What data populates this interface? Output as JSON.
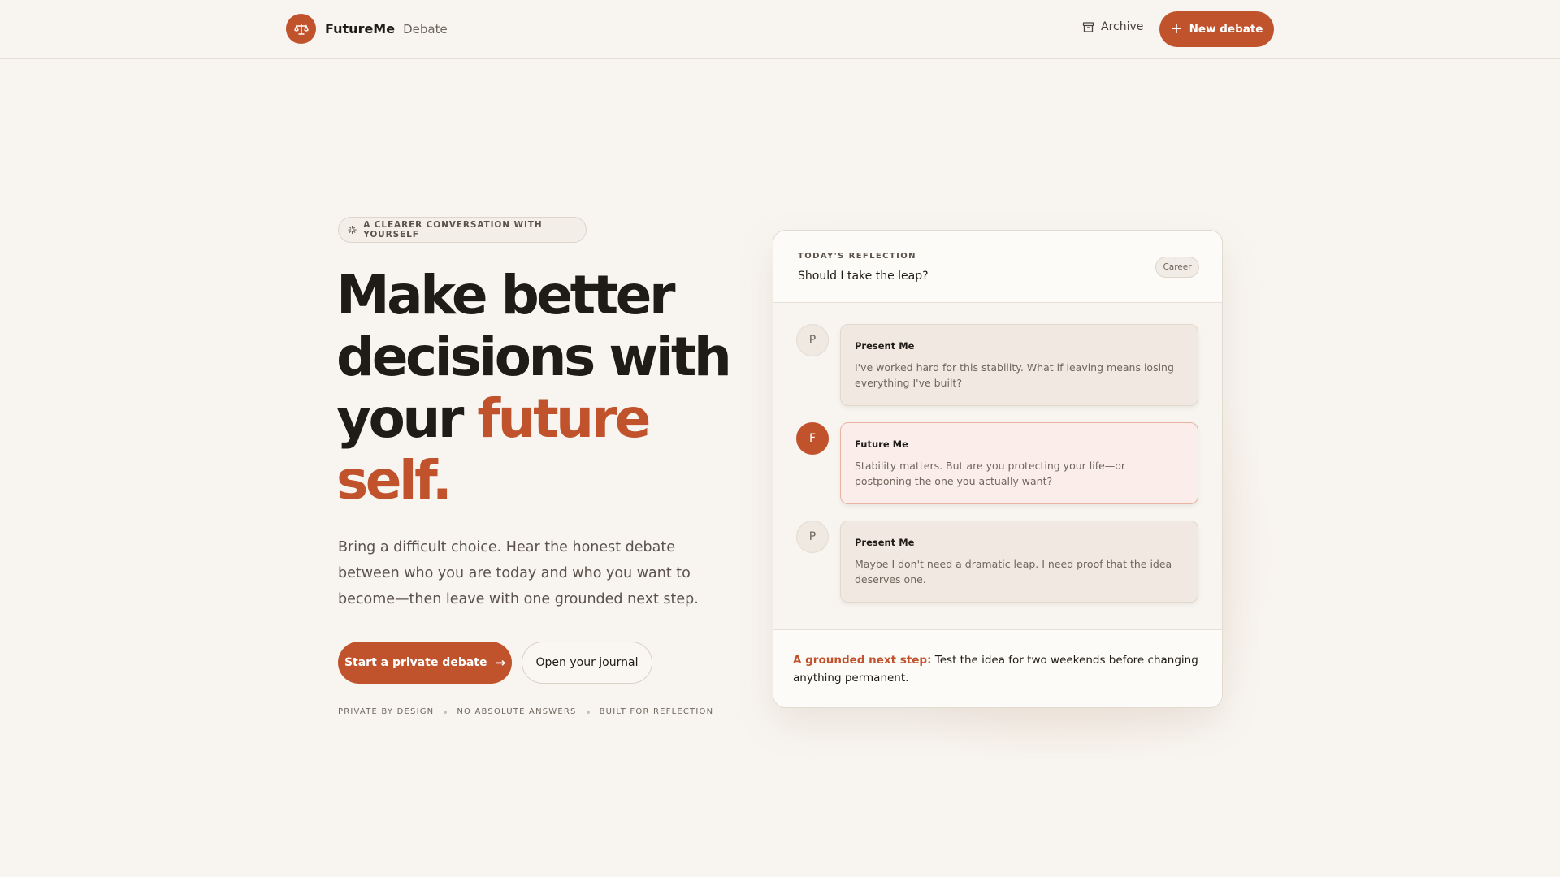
{
  "header": {
    "brand_name": "FutureMe",
    "brand_sub": "Debate",
    "archive_label": "Archive",
    "new_label": "New debate"
  },
  "hero": {
    "eyebrow": "A CLEARER CONVERSATION WITH YOURSELF",
    "headline_1": "Make better",
    "headline_2": "decisions with",
    "headline_3": "your",
    "headline_accent_1": "future",
    "headline_accent_2": "self.",
    "lead": "Bring a difficult choice. Hear the honest debate between who you are today and who you want to become—then leave with one grounded next step.",
    "cta_primary": "Start a private debate",
    "cta_secondary": "Open your journal",
    "tags": [
      "PRIVATE BY DESIGN",
      "NO ABSOLUTE ANSWERS",
      "BUILT FOR REFLECTION"
    ]
  },
  "card": {
    "kicker": "TODAY'S REFLECTION",
    "title": "Should I take the leap?",
    "chip": "Career",
    "messages": [
      {
        "initial": "P",
        "speaker": "Present Me",
        "text": "I've worked hard for this stability. What if leaving means losing everything I've built?"
      },
      {
        "initial": "F",
        "speaker": "Future Me",
        "text": "Stability matters. But are you protecting your life—or postponing the one you actually want?"
      },
      {
        "initial": "P",
        "speaker": "Present Me",
        "text": "Maybe I don't need a dramatic leap. I need proof that the idea deserves one."
      }
    ],
    "next_step_label": "A grounded next step:",
    "next_step_text": "Test the idea for two weekends before changing anything permanent."
  },
  "colors": {
    "accent": "#c0532c",
    "background": "#f8f5f0",
    "text": "#1f1b17",
    "muted": "#6f665c"
  },
  "icons": {
    "brand": "scales-icon",
    "archive": "archive-box-icon",
    "eyebrow": "sparkle-icon",
    "new": "plus-icon",
    "cta": "arrow-right-icon"
  }
}
